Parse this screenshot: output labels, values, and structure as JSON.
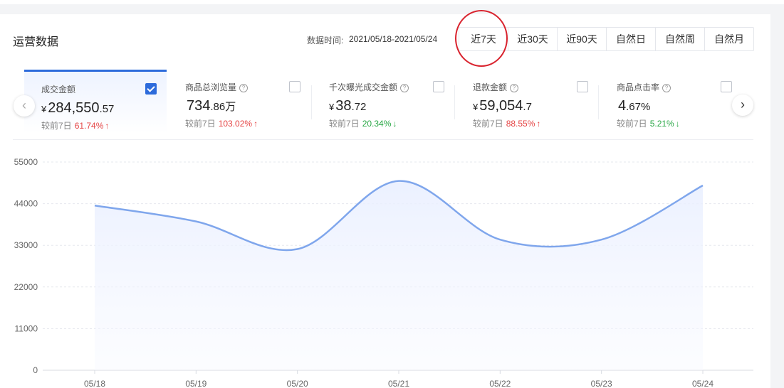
{
  "header": {
    "title": "运营数据",
    "range_label": "数据时间:",
    "range_value": "2021/05/18-2021/05/24",
    "tabs": [
      {
        "label": "近7天",
        "active": true
      },
      {
        "label": "近30天",
        "active": false
      },
      {
        "label": "近90天",
        "active": false
      },
      {
        "label": "自然日",
        "active": false
      },
      {
        "label": "自然周",
        "active": false
      },
      {
        "label": "自然月",
        "active": false
      }
    ]
  },
  "metrics": [
    {
      "name": "成交金额",
      "help": false,
      "checked": true,
      "currency": "¥",
      "value_main": "284,550",
      "value_small": ".57",
      "compare_label": "较前7日",
      "compare_value": "61.74%",
      "trend": "up"
    },
    {
      "name": "商品总浏览量",
      "help": true,
      "checked": false,
      "currency": "",
      "value_main": "734",
      "value_small": ".86万",
      "compare_label": "较前7日",
      "compare_value": "103.02%",
      "trend": "up"
    },
    {
      "name": "千次曝光成交金额",
      "help": true,
      "checked": false,
      "currency": "¥",
      "value_main": "38",
      "value_small": ".72",
      "compare_label": "较前7日",
      "compare_value": "20.34%",
      "trend": "down"
    },
    {
      "name": "退款金额",
      "help": true,
      "checked": false,
      "currency": "¥",
      "value_main": "59,054",
      "value_small": ".7",
      "compare_label": "较前7日",
      "compare_value": "88.55%",
      "trend": "up"
    },
    {
      "name": "商品点击率",
      "help": true,
      "checked": false,
      "currency": "",
      "value_main": "4",
      "value_small": ".67%",
      "compare_label": "较前7日",
      "compare_value": "5.21%",
      "trend": "down"
    }
  ],
  "nav": {
    "prev_icon": "chevron-left-icon",
    "next_icon": "chevron-right-icon"
  },
  "colors": {
    "accent": "#2d6bdb",
    "line": "#7fa6ec",
    "up": "#e54545",
    "down": "#28a745",
    "highlight": "#d9232e"
  },
  "chart_data": {
    "type": "area",
    "x": [
      "05/18",
      "05/19",
      "05/20",
      "05/21",
      "05/22",
      "05/23",
      "05/24"
    ],
    "series": [
      {
        "values": [
          43500,
          39300,
          32000,
          50000,
          34500,
          34500,
          48800
        ]
      }
    ],
    "yticks": [
      "0",
      "11000",
      "22000",
      "33000",
      "44000",
      "55000"
    ],
    "ylim": [
      0,
      55000
    ],
    "grid": true,
    "smooth": true
  }
}
